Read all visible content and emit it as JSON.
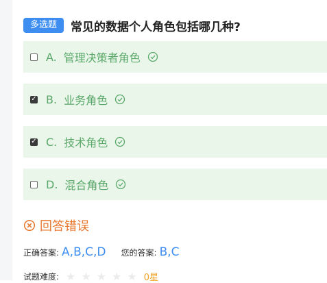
{
  "question": {
    "type_badge": "多选题",
    "title": "常见的数据个人角色包括哪几种?"
  },
  "options": [
    {
      "letter": "A.",
      "text": "管理决策者角色",
      "checked": false
    },
    {
      "letter": "B.",
      "text": "业务角色",
      "checked": true
    },
    {
      "letter": "C.",
      "text": "技术角色",
      "checked": true
    },
    {
      "letter": "D.",
      "text": "混合角色",
      "checked": false
    }
  ],
  "result": {
    "text": "回答错误",
    "color": "#e8772e"
  },
  "answers": {
    "correct_label": "正确答案:",
    "correct_value": "A,B,C,D",
    "yours_label": "您的答案:",
    "yours_value": "B,C"
  },
  "difficulty": {
    "label": "试题难度:",
    "stars_total": 5,
    "stars_filled": 0,
    "stars_text": "0星"
  },
  "colors": {
    "accent": "#3d8ef0",
    "option_bg": "#eaf6ea",
    "option_text": "#5aa86a",
    "error": "#e8772e",
    "star": "#f0a020"
  }
}
